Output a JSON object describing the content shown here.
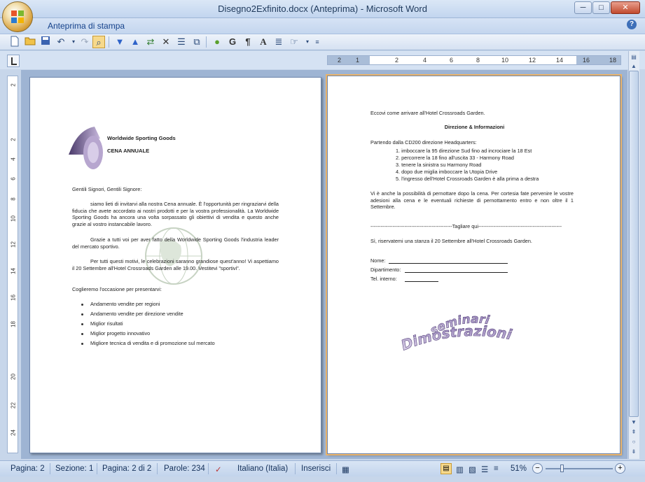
{
  "window": {
    "title": "Disegno2Exfinito.docx (Anteprima) - Microsoft Word",
    "minimize": "─",
    "maximize": "□",
    "close": "✕"
  },
  "ribbon": {
    "tab_label": "Anteprima di stampa",
    "help": "?"
  },
  "toolbar": {
    "buttons": [
      "new-icon",
      "open-icon",
      "save-icon",
      "undo-icon",
      "redo-icon",
      "preview-icon",
      "down-icon",
      "up-icon",
      "shrink-icon",
      "close-icon",
      "lines-icon",
      "pages-icon",
      "dot-icon",
      "bold-g-icon",
      "pilcrow-icon",
      "font-a-icon",
      "format-icon",
      "dropdown-icon",
      "more-icon"
    ],
    "bold_g": "G",
    "pilcrow": "¶",
    "font_a": "A"
  },
  "ruler": {
    "h_ticks": [
      "2",
      "1",
      "2",
      "4",
      "6",
      "8",
      "10",
      "12",
      "14",
      "16",
      "18"
    ],
    "v_ticks": [
      "2",
      "2",
      "4",
      "6",
      "8",
      "10",
      "12",
      "14",
      "16",
      "18",
      "20",
      "22",
      "24"
    ]
  },
  "page1": {
    "company": "Worldwide Sporting Goods",
    "event": "CENA ANNUALE",
    "greeting": "Gentili Signori, Gentili Signore:",
    "para1": "siamo lieti di invitarvi alla nostra Cena annuale. È l'opportunità per ringraziarvi della fiducia che avete accordato ai nostri prodotti e per la vostra professionalità. La Worldwide Sporting Goods ha ancora una volta sorpassato gli obiettivi di vendita e questo anche grazie al vostro instancabile lavoro.",
    "para2": "Grazie a tutti voi per aver fatto della Worldwide Sporting Goods l'industria leader del mercato sportivo.",
    "para3": "Per tutti questi motivi, le celebrazioni saranno grandiose quest'anno! Vi aspettiamo il 20 Settembre all'Hotel Crossroads Garden alle 19.00. Vestitevi \"sportivi\".",
    "para4": "Coglieremo l'occasione per presentarvi:",
    "bullets": [
      "Andamento vendite per regioni",
      "Andamento vendite per direzione vendite",
      "Miglior risultati",
      "Miglior progetto innovativo",
      "Migliore tecnica di vendita e di promozione sul mercato"
    ]
  },
  "page2": {
    "intro": "Eccovi come arrivare all'Hotel Crossroads Garden.",
    "heading": "Direzione & Informazioni",
    "start": "Partendo dalla CD200 direzione Headquarters:",
    "steps": [
      "1.   imboccare la 95 direzione Sud fino ad incrociare la 18 Est",
      "2.   percorrere la 18 fino all'uscita 33 - Harmony Road",
      "3.   tenere la sinistra su Harmony Road",
      "4.   dopo due miglia imboccare la Utopia Drive",
      "5.   l'ingresso dell'Hotel Crossroads Garden è alla prima a destra"
    ],
    "note": "Vi è anche la possibilità di pernottare dopo la cena. Per cortesia fate pervenire le vostre adesioni alla cena e le eventuali richieste di pernottamento entro e non oltre il 1 Settembre.",
    "cut": "------------------------------------------------Tagliare qui-------------------------------------------------",
    "reserve": "Sì, riservatemi una stanza il 20 Settembre all'Hotel Crossroads Garden.",
    "name_label": "Nome:",
    "dept_label": "Dipartimento:",
    "tel_label": "Tel. interno:",
    "wordart1": "seminari",
    "wordart2": "Dimostrazioni"
  },
  "status": {
    "page": "Pagina: 2",
    "section": "Sezione: 1",
    "pages": "Pagina: 2 di 2",
    "words": "Parole: 234",
    "language": "Italiano (Italia)",
    "mode": "Inserisci",
    "zoom": "51%",
    "zoom_level": 0.51,
    "zoom_out": "−",
    "zoom_in": "+"
  }
}
